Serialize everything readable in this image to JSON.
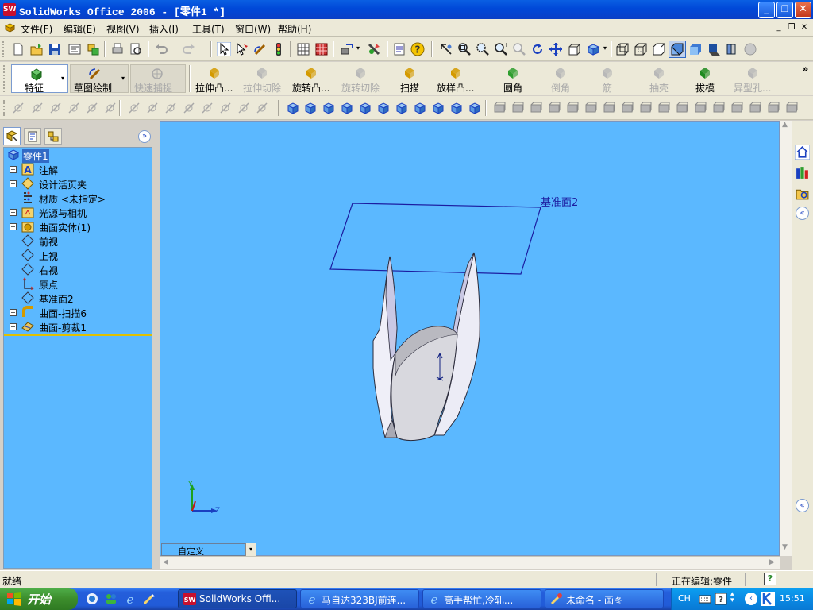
{
  "window": {
    "title": "SolidWorks Office 2006 - [零件1 *]",
    "app_icon_label": "SW"
  },
  "menu": {
    "items": [
      "文件(F)",
      "编辑(E)",
      "视图(V)",
      "插入(I)",
      "工具(T)",
      "窗口(W)",
      "帮助(H)"
    ]
  },
  "command_manager": {
    "tabs": [
      {
        "label": "特征"
      },
      {
        "label": "草图绘制"
      },
      {
        "label": "快速捕捉"
      }
    ],
    "commands": [
      {
        "label": "拉伸凸...",
        "enabled": true
      },
      {
        "label": "拉伸切除",
        "enabled": false
      },
      {
        "label": "旋转凸...",
        "enabled": true
      },
      {
        "label": "旋转切除",
        "enabled": false
      },
      {
        "label": "扫描",
        "enabled": true
      },
      {
        "label": "放样凸...",
        "enabled": true
      },
      {
        "label": "圆角",
        "enabled": true
      },
      {
        "label": "倒角",
        "enabled": false
      },
      {
        "label": "筋",
        "enabled": false
      },
      {
        "label": "抽壳",
        "enabled": false
      },
      {
        "label": "拔模",
        "enabled": true
      },
      {
        "label": "异型孔...",
        "enabled": false
      }
    ],
    "more": "»"
  },
  "feature_tree": {
    "root": "零件1",
    "items": [
      {
        "label": "注解",
        "expandable": true,
        "icon": "annotations-icon"
      },
      {
        "label": "设计活页夹",
        "expandable": true,
        "icon": "design-binder-icon"
      },
      {
        "label": "材质 <未指定>",
        "expandable": false,
        "icon": "material-icon"
      },
      {
        "label": "光源与相机",
        "expandable": true,
        "icon": "lights-camera-icon"
      },
      {
        "label": "曲面实体(1)",
        "expandable": true,
        "icon": "surface-bodies-icon"
      },
      {
        "label": "前视",
        "expandable": false,
        "icon": "plane-icon"
      },
      {
        "label": "上视",
        "expandable": false,
        "icon": "plane-icon"
      },
      {
        "label": "右视",
        "expandable": false,
        "icon": "plane-icon"
      },
      {
        "label": "原点",
        "expandable": false,
        "icon": "origin-icon"
      },
      {
        "label": "基准面2",
        "expandable": false,
        "icon": "plane-icon"
      },
      {
        "label": "曲面-扫描6",
        "expandable": true,
        "icon": "surface-sweep-icon"
      },
      {
        "label": "曲面-剪裁1",
        "expandable": true,
        "icon": "surface-trim-icon"
      }
    ]
  },
  "viewport": {
    "plane_label": "基准面2",
    "triad": {
      "y": "Y",
      "z": "Z"
    },
    "view_select": "自定义",
    "background": "#5bb8ff"
  },
  "status": {
    "left": "就绪",
    "editing": "正在编辑:零件",
    "help": "?"
  },
  "taskbar": {
    "start": "开始",
    "tasks": [
      {
        "label": "SolidWorks Offi...",
        "active": true
      },
      {
        "label": "马自达323BJ前连...",
        "active": false
      },
      {
        "label": "高手帮忙,冷轧...",
        "active": false
      },
      {
        "label": "未命名 - 画图",
        "active": false
      }
    ],
    "ime": "CH",
    "clock": "15:51"
  },
  "colors": {
    "title_blue": "#0a5fe3",
    "viewport_blue": "#5bb8ff",
    "plane_line": "#1c1ca0",
    "start_green": "#3c8d2c"
  }
}
